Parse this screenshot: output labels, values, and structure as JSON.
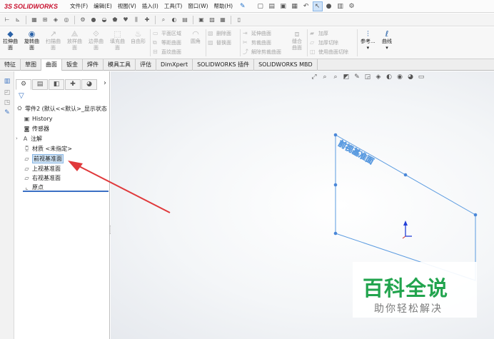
{
  "app": {
    "logo_prefix": "3S",
    "logo_name": "SOLIDWORKS"
  },
  "menu": [
    "文件(F)",
    "编辑(E)",
    "视图(V)",
    "插入(I)",
    "工具(T)",
    "窗口(W)",
    "帮助(H)"
  ],
  "ribbon": {
    "extrude": [
      "拉伸曲",
      "面"
    ],
    "revolve": [
      "旋转曲",
      "面"
    ],
    "sweep": [
      "扫描曲",
      "面"
    ],
    "loft": [
      "放样曲",
      "面"
    ],
    "boundary": [
      "边界曲",
      "面"
    ],
    "fill": [
      "填充曲",
      "面"
    ],
    "freeform": "自由形",
    "planar": "平面区域",
    "offset": "等距曲面",
    "ruled": "直纹曲面",
    "round": "圆角",
    "delete_face": "删除面",
    "replace_face": "替换面",
    "extend": "延伸曲面",
    "trim": "剪裁曲面",
    "untrim": "解除剪裁曲面",
    "knit": [
      "缝合",
      "曲面"
    ],
    "thicken": "加厚",
    "thicken_cut": "加厚切除",
    "surface_cut": "使用曲面切除",
    "reference": "参考...",
    "curves": "曲线"
  },
  "tabs": [
    "特征",
    "草图",
    "曲面",
    "钣金",
    "焊件",
    "模具工具",
    "评估",
    "DimXpert",
    "SOLIDWORKS 插件",
    "SOLIDWORKS MBD"
  ],
  "active_tab": "曲面",
  "tree": {
    "root": "零件2 (默认<<默认>_显示状态",
    "items": [
      "History",
      "传感器",
      "注解",
      "材质 <未指定>",
      "前视基准面",
      "上视基准面",
      "右视基准面",
      "原点"
    ]
  },
  "viewport": {
    "plane_label": "前视基准面"
  },
  "watermark": {
    "main": "百科全说",
    "sub": "助你轻松解决"
  },
  "colors": {
    "plane": "#5b9be0",
    "arrow": "#e0393b",
    "brand": "#c8102e",
    "watermark": "#22a44e",
    "triad": "#2340d8"
  }
}
